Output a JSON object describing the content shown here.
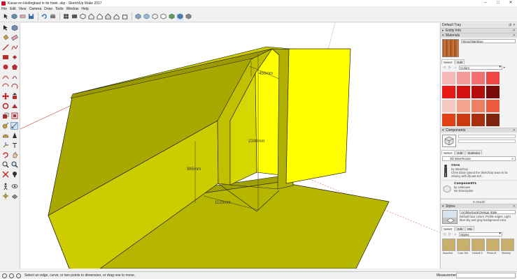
{
  "window": {
    "title": "Kasse en kledingkast in de hoek .skp - SketchUp Make 2017",
    "controls": [
      "–",
      "□",
      "✕"
    ]
  },
  "menu": [
    "File",
    "Edit",
    "View",
    "Camera",
    "Draw",
    "Tools",
    "Window",
    "Help"
  ],
  "toolbar": {
    "icons": [
      "select-icon",
      "component-icon",
      "new-icon",
      "open-icon",
      "save-icon",
      "undo-icon",
      "redo-icon",
      "geo-location-icon",
      "warehouse-icon",
      "iso-view-icon",
      "top-view-icon",
      "front-view-icon",
      "right-view-icon",
      "back-view-icon",
      "left-view-icon",
      "xray-icon",
      "wireframe-icon",
      "hidden-line-icon",
      "shaded-icon",
      "textured-icon",
      "monochrome-icon"
    ]
  },
  "viewport": {
    "dimensions": [
      "450mm",
      "2330mm",
      "965mm",
      "1125mm"
    ]
  },
  "tray": {
    "title": "Default Tray",
    "entity_info": "Entity Info",
    "materials": {
      "header": "Materials",
      "current_material": "Wood Bamboo",
      "tabs": [
        "Select",
        "Edit"
      ],
      "library": "Colors",
      "swatches": [
        "#f4b8b8",
        "#f49a9a",
        "#f27070",
        "#f04545",
        "#e81818",
        "#d41010",
        "#b80d0d",
        "#7a0a0a",
        "#f6c9c0",
        "#f2a48f",
        "#ee7e64",
        "#ea5a3c",
        "#e24216",
        "#cd3a12",
        "#a83010",
        "#7e240c"
      ]
    },
    "components": {
      "header": "Components",
      "tabs": [
        "Select",
        "Edit",
        "Statistics"
      ],
      "search_placeholder": "3D Warehouse",
      "results": [
        {
          "name": "Chris",
          "by": "by SketchUp",
          "desc": "Chris Dizon joined the SketchUp team in its infancy with @Last Sof..."
        },
        {
          "name": "Component#1",
          "by": "by Unknown",
          "desc": "No Description"
        }
      ],
      "footer": "In Model"
    },
    "styles": {
      "header": "Styles",
      "style_name": "Architectural Design Style",
      "style_desc": "Default face colors. Profile edges. Light blue sky and gray background color.",
      "tabs": [
        "Select",
        "Edit",
        "Mix"
      ],
      "library": "Styles",
      "thumbs": [
        "Assorted",
        "Color Set",
        "Default S",
        "Photo M",
        "Sketchy"
      ]
    }
  },
  "status": {
    "message": "Select an edge, curve, or two points to dimension, or drag one to move.",
    "measurements_label": "Measurements"
  },
  "colors": {
    "face_yellow": "#cccc00",
    "face_bright": "#ffff00",
    "face_dark": "#a8a800",
    "edge": "#1a1a1a",
    "axis_red": "#c04040",
    "axis_green": "#409040"
  }
}
